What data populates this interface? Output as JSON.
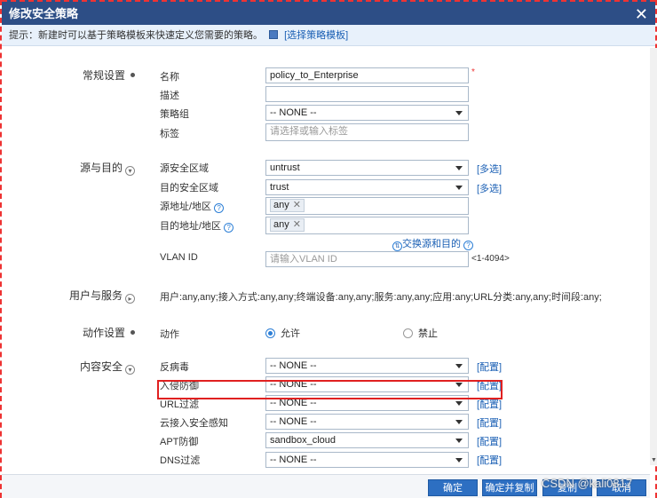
{
  "dialog": {
    "title": "修改安全策略"
  },
  "tip": {
    "text": "提示：新建时可以基于策略模板来快速定义您需要的策略。",
    "template_link": "[选择策略模板]"
  },
  "sections": {
    "general": "常规设置",
    "src_dst": "源与目的",
    "user_service": "用户与服务",
    "action": "动作设置",
    "content": "内容安全"
  },
  "general": {
    "name_label": "名称",
    "name_value": "policy_to_Enterprise",
    "required_mark": "*",
    "desc_label": "描述",
    "desc_value": "",
    "group_label": "策略组",
    "group_value": "-- NONE --",
    "tag_label": "标签",
    "tag_placeholder": "请选择或输入标签"
  },
  "src_dst": {
    "src_zone_label": "源安全区域",
    "src_zone_value": "untrust",
    "dst_zone_label": "目的安全区域",
    "dst_zone_value": "trust",
    "multi_select": "[多选]",
    "src_addr_label": "源地址/地区",
    "src_addr_tag": "any",
    "dst_addr_label": "目的地址/地区",
    "dst_addr_tag": "any",
    "swap_label": "交换源和目的",
    "vlan_label": "VLAN ID",
    "vlan_placeholder": "请输入VLAN ID",
    "vlan_range": "<1-4094>"
  },
  "user_service": {
    "summary": "用户:any,any;接入方式:any,any;终端设备:any,any;服务:any,any;应用:any;URL分类:any,any;时间段:any;"
  },
  "action": {
    "label": "动作",
    "permit": "允许",
    "deny": "禁止",
    "selected": "permit"
  },
  "content": {
    "config_link": "[配置]",
    "rows": [
      {
        "label": "反病毒",
        "value": "-- NONE --"
      },
      {
        "label": "入侵防御",
        "value": "-- NONE --"
      },
      {
        "label": "URL过滤",
        "value": "-- NONE --"
      },
      {
        "label": "云接入安全感知",
        "value": "-- NONE --"
      },
      {
        "label": "APT防御",
        "value": "sandbox_cloud"
      },
      {
        "label": "DNS过滤",
        "value": "-- NONE --"
      }
    ]
  },
  "footer": {
    "ok": "确定",
    "ok_copy": "确定并复制",
    "copy": "复制",
    "cancel": "取消"
  },
  "watermark": "CSDN @kali0817",
  "colors": {
    "titlebar": "#2d4e86",
    "button": "#2d6fc2",
    "highlight": "#e02020",
    "link": "#1a5fb4"
  }
}
